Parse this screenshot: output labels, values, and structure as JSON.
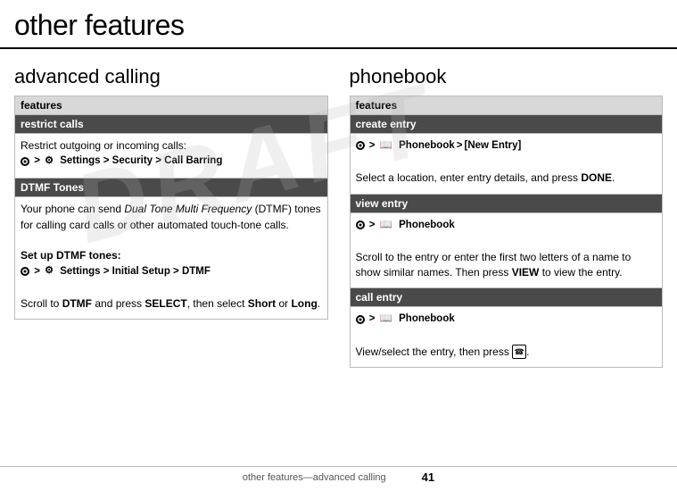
{
  "page": {
    "title": "other features",
    "draft_watermark": "DRAFT",
    "footer_left": "other features—advanced calling",
    "footer_page": "41"
  },
  "left_section": {
    "heading": "advanced calling",
    "table_header": "features",
    "rows": [
      {
        "name": "restrict calls",
        "content_lines": [
          "Restrict outgoing or incoming calls:",
          "nav_restrict"
        ]
      },
      {
        "name": "DTMF Tones",
        "content_lines": [
          "Your phone can send Dual Tone Multi Frequency (DTMF) tones for calling card calls or other automated touch-tone calls.",
          "Set up DTMF tones:",
          "nav_dtmf",
          "Scroll to DTMF and press SELECT, then select Short or Long."
        ]
      }
    ],
    "nav_restrict": "⦾ > ⚙ Settings > Security > Call Barring",
    "nav_dtmf": "⦾ > ⚙ Settings > Initial Setup > DTMF",
    "set_up_dtmf_label": "Set up DTMF tones:",
    "scroll_dtmf_text": "Scroll to DTMF and press SELECT, then select Short or Long.",
    "restrict_text": "Restrict outgoing or incoming calls:"
  },
  "right_section": {
    "heading": "phonebook",
    "table_header": "features",
    "rows": [
      {
        "name": "create entry",
        "nav": "⦾ > 📖 Phonebook > [New Entry]",
        "content": "Select a location, enter entry details, and press DONE."
      },
      {
        "name": "view entry",
        "nav": "⦾ > 📖 Phonebook",
        "content": "Scroll to the entry or enter the first two letters of a name to show similar names. Then press VIEW to view the entry."
      },
      {
        "name": "call entry",
        "nav": "⦾ > 📖 Phonebook",
        "content": "View/select the entry, then press ☎."
      }
    ]
  }
}
